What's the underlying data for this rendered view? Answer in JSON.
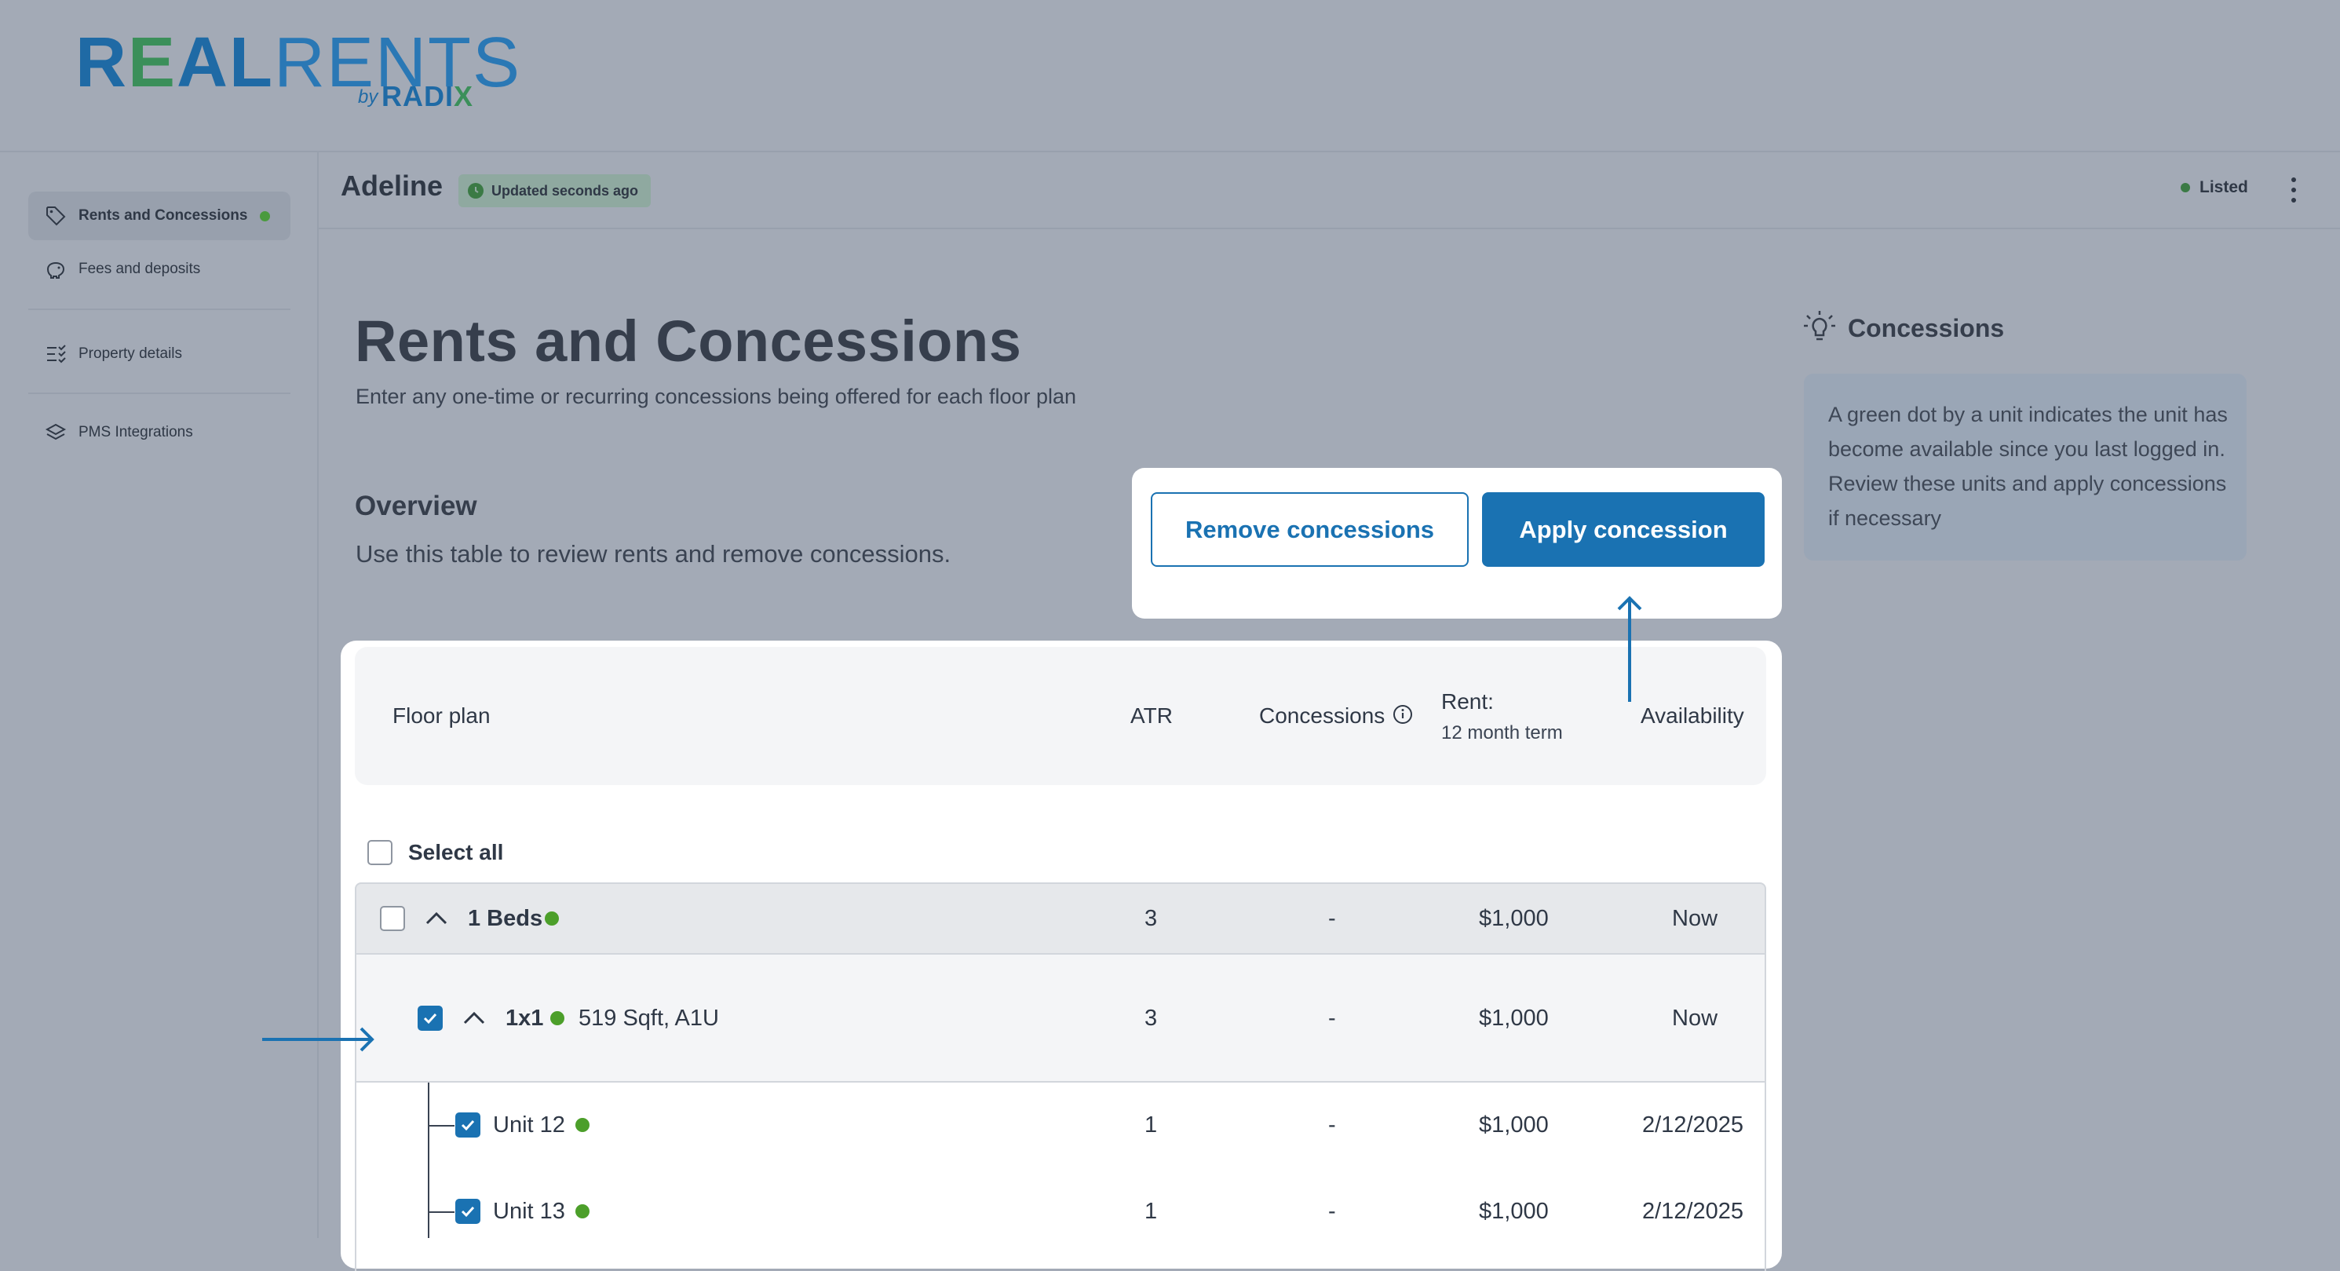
{
  "logo": {
    "real_r": "R",
    "real_e": "E",
    "real_al": "AL",
    "rents": "RENTS",
    "by": "by",
    "radix_radi": "RADI",
    "radix_x": "X"
  },
  "sidebar": {
    "items": [
      {
        "label": "Rents and Concessions",
        "icon": "tag-icon",
        "active": true,
        "dot": true
      },
      {
        "label": "Fees and deposits",
        "icon": "piggy-bank-icon",
        "active": false
      },
      {
        "label": "Property details",
        "icon": "checklist-icon",
        "active": false
      },
      {
        "label": "PMS Integrations",
        "icon": "layers-icon",
        "active": false
      }
    ]
  },
  "header": {
    "property_name": "Adeline",
    "updated_badge": "Updated seconds ago",
    "status": "Listed"
  },
  "page": {
    "title": "Rents and Concessions",
    "subtitle": "Enter any one-time or recurring concessions being offered for each floor plan",
    "overview_title": "Overview",
    "overview_sub": "Use this table to review rents and remove concessions."
  },
  "actions": {
    "remove_label": "Remove concessions",
    "apply_label": "Apply concession"
  },
  "tips": {
    "title": "Concessions",
    "body": "A green dot by a unit indicates the unit has become available since you last logged in. Review these units and apply concessions if necessary"
  },
  "table": {
    "headers": {
      "floor_plan": "Floor plan",
      "atr": "ATR",
      "concessions": "Concessions",
      "rent": "Rent:",
      "rent_sub": "12 month term",
      "availability": "Availability"
    },
    "select_all": "Select all",
    "group": {
      "name": "1 Beds",
      "atr": "3",
      "concessions": "-",
      "rent": "$1,000",
      "availability": "Now",
      "checked": false
    },
    "floorplan": {
      "name": "1x1",
      "detail": "519 Sqft, A1U",
      "atr": "3",
      "concessions": "-",
      "rent": "$1,000",
      "availability": "Now",
      "checked": true
    },
    "units": [
      {
        "name": "Unit 12",
        "atr": "1",
        "concessions": "-",
        "rent": "$1,000",
        "availability": "2/12/2025",
        "checked": true
      },
      {
        "name": "Unit 13",
        "atr": "1",
        "concessions": "-",
        "rent": "$1,000",
        "availability": "2/12/2025",
        "checked": true
      }
    ]
  },
  "colors": {
    "accent": "#1a72b2",
    "green_dot": "#4c9f2a",
    "overlay": "#a3aab6"
  }
}
